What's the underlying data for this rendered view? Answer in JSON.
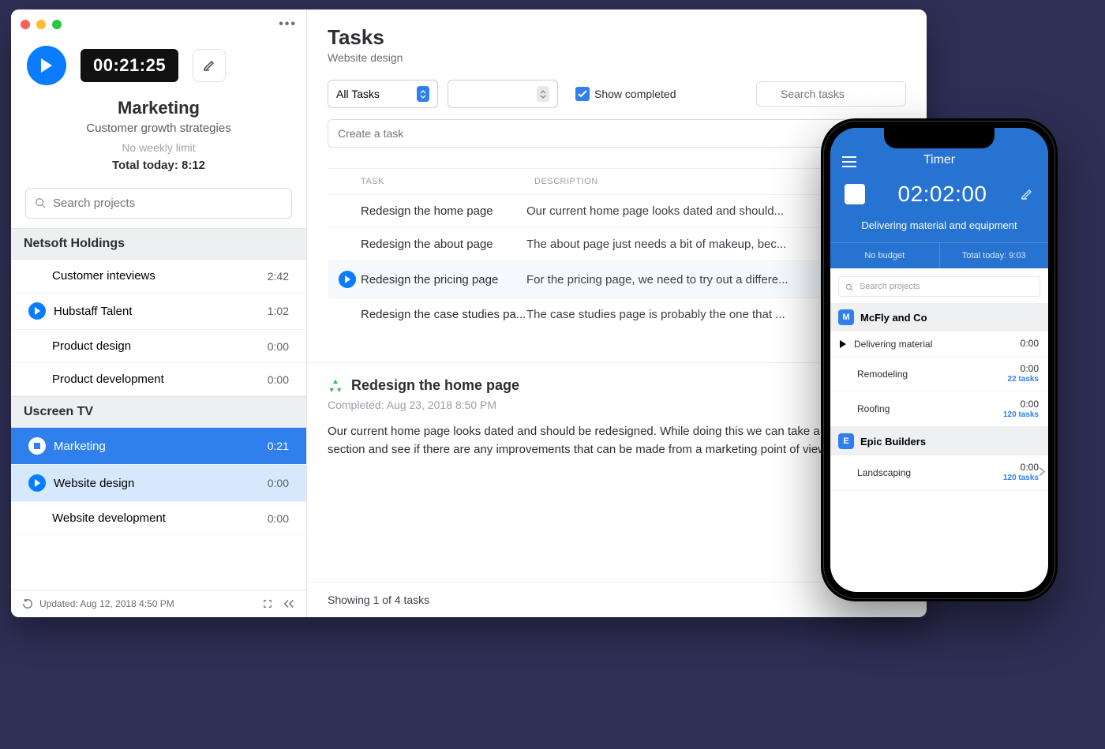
{
  "sidebar": {
    "timer": "00:21:25",
    "project": "Marketing",
    "subtitle": "Customer growth strategies",
    "limit": "No weekly limit",
    "total_today": "Total today: 8:12",
    "search_placeholder": "Search projects",
    "groups": [
      {
        "name": "Netsoft Holdings",
        "projects": [
          {
            "name": "Customer inteviews",
            "time": "2:42",
            "icon": null,
            "state": ""
          },
          {
            "name": "Hubstaff Talent",
            "time": "1:02",
            "icon": "play",
            "state": ""
          },
          {
            "name": "Product design",
            "time": "0:00",
            "icon": null,
            "state": ""
          },
          {
            "name": "Product development",
            "time": "0:00",
            "icon": null,
            "state": ""
          }
        ]
      },
      {
        "name": "Uscreen TV",
        "projects": [
          {
            "name": "Marketing",
            "time": "0:21",
            "icon": "stop",
            "state": "active"
          },
          {
            "name": "Website design",
            "time": "0:00",
            "icon": "play",
            "state": "sub-active"
          },
          {
            "name": "Website development",
            "time": "0:00",
            "icon": null,
            "state": ""
          }
        ]
      }
    ],
    "footer_updated": "Updated: Aug 12, 2018 4:50 PM"
  },
  "main": {
    "title": "Tasks",
    "subtitle": "Website design",
    "filter_all": "All Tasks",
    "show_completed": "Show completed",
    "search_placeholder": "Search tasks",
    "create_placeholder": "Create a task",
    "th_task": "TASK",
    "th_desc": "DESCRIPTION",
    "rows": [
      {
        "name": "Redesign the home page",
        "desc": "Our current home page looks dated and should...",
        "selected": false,
        "play": false
      },
      {
        "name": "Redesign the about page",
        "desc": "The about page just needs a bit of makeup, bec...",
        "selected": false,
        "play": false
      },
      {
        "name": "Redesign the pricing page",
        "desc": "For the pricing page, we need to try out a differe...",
        "selected": true,
        "play": true
      },
      {
        "name": "Redesign the case studies pa...",
        "desc": "The case studies page is probably the one that ...",
        "selected": false,
        "play": false
      }
    ],
    "detail_title": "Redesign the home page",
    "detail_completed": "Completed: Aug 23, 2018 8:50 PM",
    "detail_body": "Our current home page looks dated and should be redesigned. While doing this we can take a look at each section and see if there are any improvements that can be made from a marketing point of view.",
    "footer": "Showing 1 of 4 tasks"
  },
  "phone": {
    "title": "Timer",
    "timer": "02:02:00",
    "task": "Delivering material and equipment",
    "stat_left": "No budget",
    "stat_right": "Total today: 9:03",
    "search_placeholder": "Search projects",
    "groups": [
      {
        "name": "McFly and Co",
        "letter": "M",
        "projects": [
          {
            "name": "Delivering material",
            "time": "0:00",
            "sub": "",
            "play": true,
            "chev": false
          },
          {
            "name": "Remodeling",
            "time": "0:00",
            "sub": "22 tasks",
            "play": false,
            "chev": false
          },
          {
            "name": "Roofing",
            "time": "0:00",
            "sub": "120 tasks",
            "play": false,
            "chev": false
          }
        ]
      },
      {
        "name": "Epic Builders",
        "letter": "E",
        "projects": [
          {
            "name": "Landscaping",
            "time": "0:00",
            "sub": "120 tasks",
            "play": false,
            "chev": true
          }
        ]
      }
    ]
  }
}
